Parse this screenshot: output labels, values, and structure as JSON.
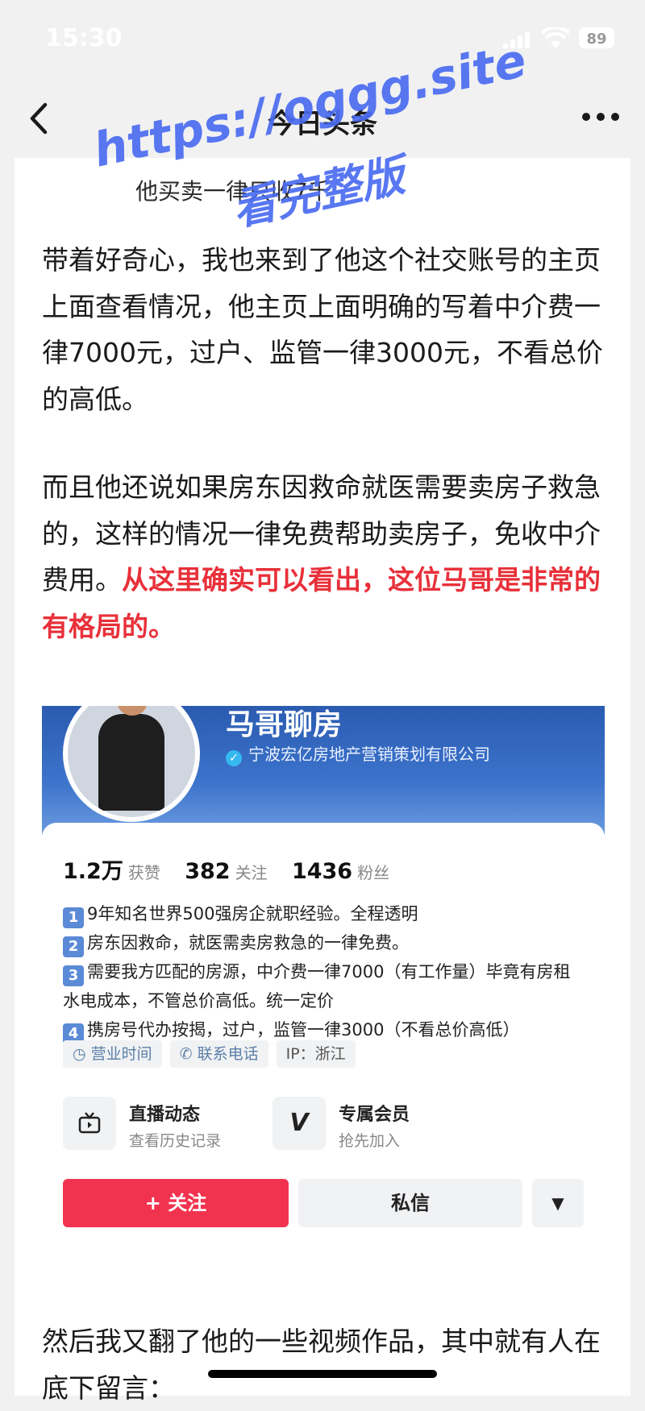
{
  "status_bar": {
    "time": "15:30",
    "battery": "89"
  },
  "nav": {
    "title": "今日头条"
  },
  "article": {
    "caption": "他买卖一律只收7千",
    "para1": "带着好奇心，我也来到了他这个社交账号的主页上面查看情况，他主页上面明确的写着中介费一律7000元，过户、监管一律3000元，不看总价的高低。",
    "para2_normal": "而且他还说如果房东因救命就医需要卖房子救急的，这样的情况一律免费帮助卖房子，免收中介费用。",
    "para2_red": "从这里确实可以看出，这位马哥是非常的有格局的。",
    "para3": "然后我又翻了他的一些视频作品，其中就有人在底下留言："
  },
  "profile": {
    "name": "马哥聊房",
    "verified_org": "宁波宏亿房地产营销策划有限公司",
    "stats": {
      "likes": "1.2万",
      "likes_label": "获赞",
      "following": "382",
      "following_label": "关注",
      "fans": "1436",
      "fans_label": "粉丝"
    },
    "bio": [
      {
        "num": "1",
        "text": "9年知名世界500强房企就职经验。全程透明"
      },
      {
        "num": "2",
        "text": "房东因救命，就医需卖房救急的一律免费。"
      },
      {
        "num": "3",
        "text": "需要我方匹配的房源，中介费一律7000（有工作量）毕竟有房租水电成本，不管总价高低。统一定价"
      },
      {
        "num": "4",
        "text": "携房号代办按揭，过户，监管一律3000（不看总价高低）"
      }
    ],
    "tags": {
      "hours": "营业时间",
      "phone": "联系电话",
      "ip": "IP：浙江"
    },
    "features": {
      "live_title": "直播动态",
      "live_sub": "查看历史记录",
      "member_title": "专属会员",
      "member_sub": "抢先加入"
    },
    "buttons": {
      "follow": "+ 关注",
      "message": "私信",
      "more": "▼"
    }
  },
  "watermark": {
    "line1": "https://oggg.site",
    "line2": "看完整版"
  },
  "icons": {
    "back": "back-chevron-icon",
    "more": "more-dots-icon",
    "signal": "signal-icon",
    "wifi": "wifi-icon",
    "live": "tv-icon",
    "member": "v-icon"
  },
  "colors": {
    "accent_red": "#e8303a",
    "follow_button": "#f2334f",
    "banner_blue": "#2a5bb0",
    "watermark": "#4a6cf0"
  }
}
